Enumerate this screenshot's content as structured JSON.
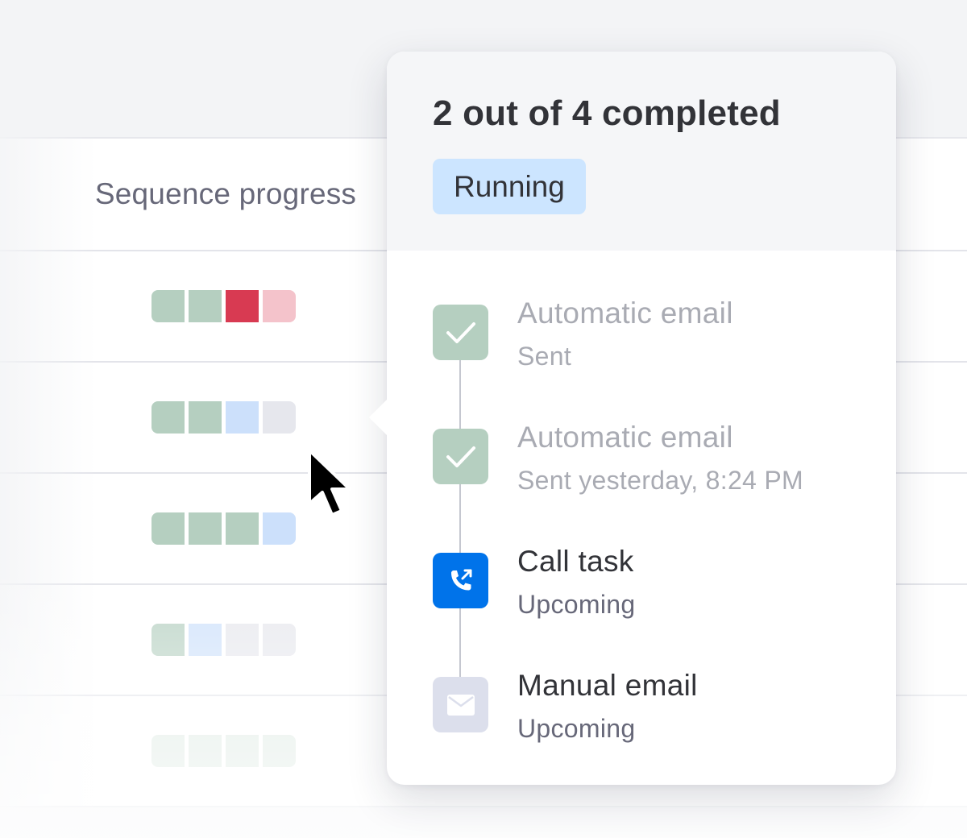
{
  "table": {
    "column_header": "Sequence progress",
    "rows": [
      {
        "segments": [
          "#b5cfc0",
          "#b5cfc0",
          "#d83a52",
          "#f4c3cb"
        ],
        "opacity": 1
      },
      {
        "segments": [
          "#b5cfc0",
          "#b5cfc0",
          "#cce0fb",
          "#e6e7ed"
        ],
        "opacity": 1
      },
      {
        "segments": [
          "#b5cfc0",
          "#b5cfc0",
          "#b5cfc0",
          "#cce0fb"
        ],
        "opacity": 1
      },
      {
        "segments": [
          "#b5cfc0",
          "#cce0fb",
          "#e6e7ed",
          "#e6e7ed"
        ],
        "opacity": 0.85
      },
      {
        "segments": [
          "#b5cfc0",
          "#b5cfc0",
          "#b5cfc0",
          "#b5cfc0"
        ],
        "opacity": 0.45
      }
    ]
  },
  "popover": {
    "title": "2 out of 4 completed",
    "status": "Running",
    "steps": [
      {
        "title": "Automatic email",
        "subtitle": "Sent",
        "state": "done",
        "icon": "check-icon"
      },
      {
        "title": "Automatic email",
        "subtitle": "Sent yesterday, 8:24 PM",
        "state": "done",
        "icon": "check-icon"
      },
      {
        "title": "Call task",
        "subtitle": "Upcoming",
        "state": "active",
        "icon": "phone-outgoing-icon"
      },
      {
        "title": "Manual email",
        "subtitle": "Upcoming",
        "state": "upcoming",
        "icon": "envelope-icon"
      }
    ]
  },
  "colors": {
    "done_step": "#b5cfc0",
    "active_step": "#0073ea",
    "upcoming_step": "#dcdfec",
    "badge_bg": "#cce5ff"
  }
}
